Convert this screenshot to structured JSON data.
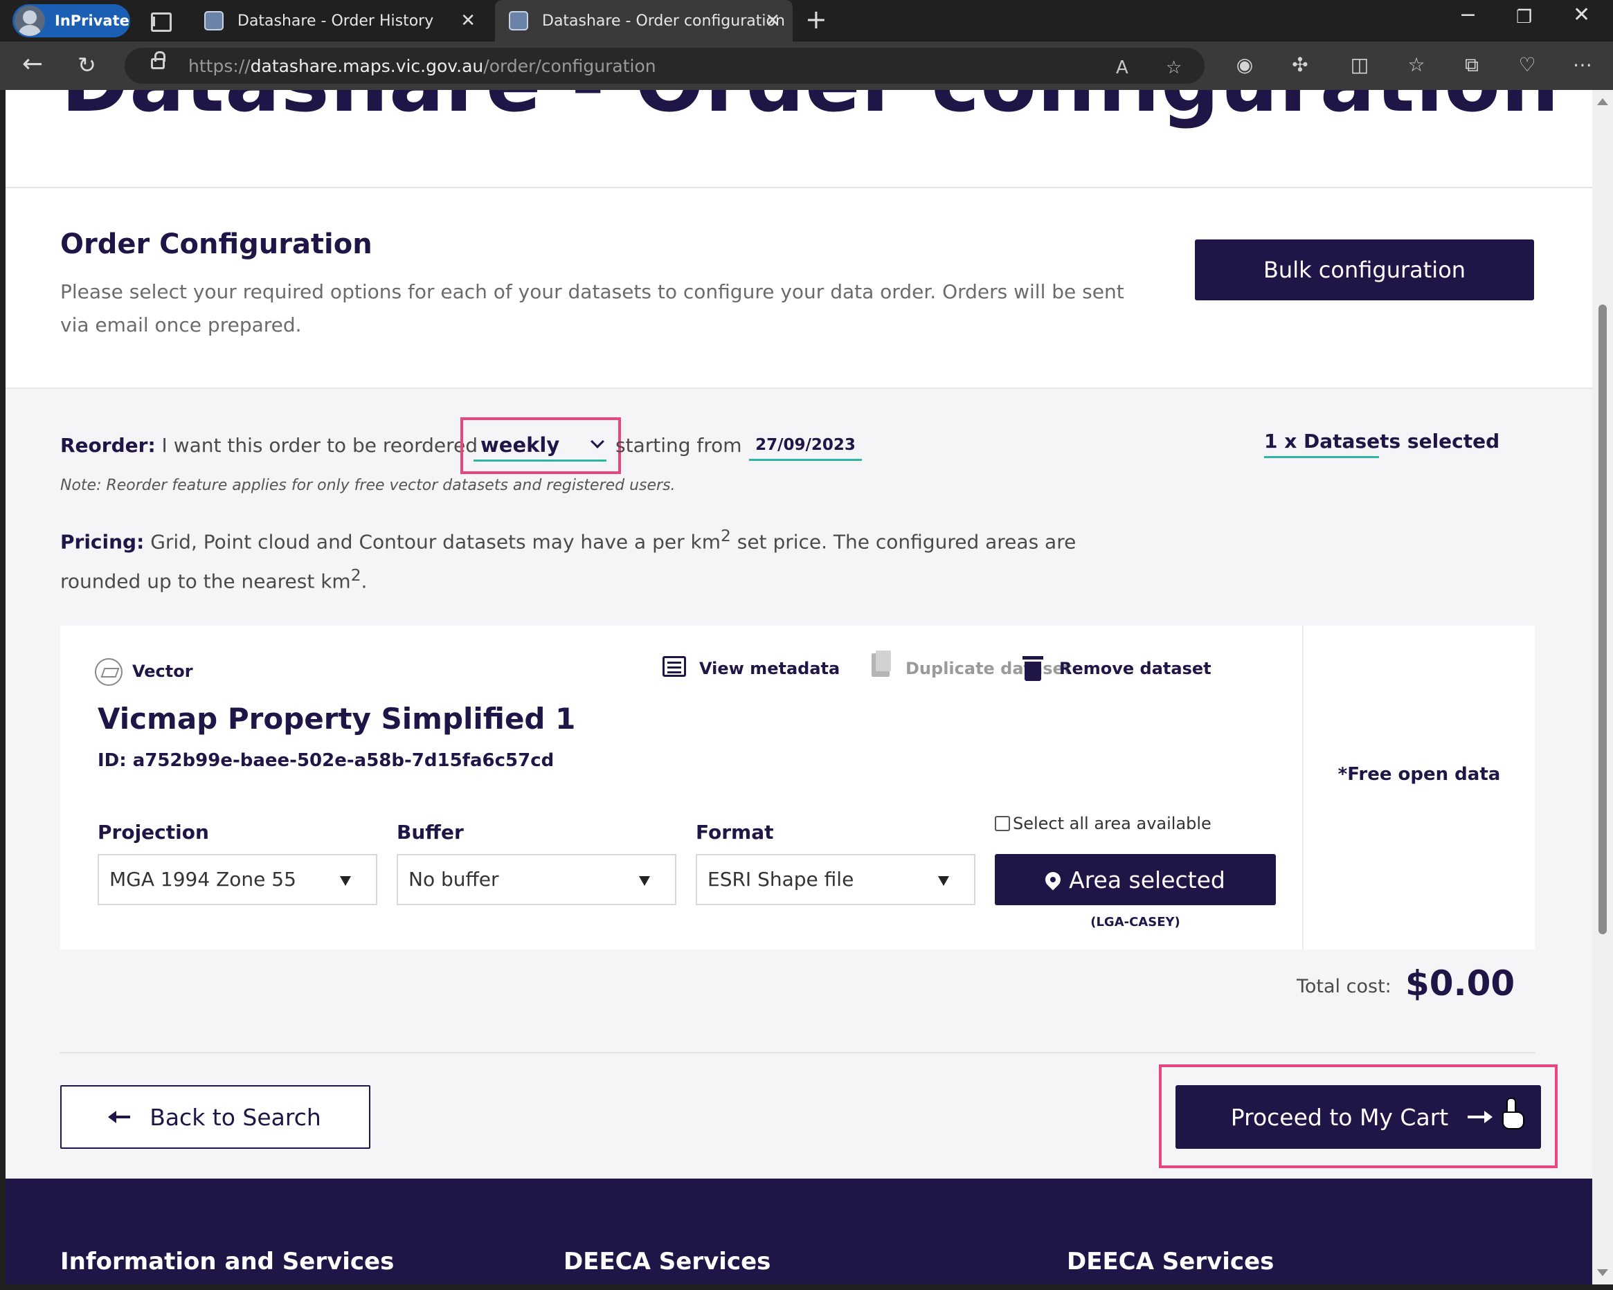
{
  "browser": {
    "inprivate_label": "InPrivate",
    "tabs": [
      {
        "title": "Datashare - Order History",
        "active": false
      },
      {
        "title": "Datashare - Order configuration",
        "active": true
      }
    ],
    "url_prefix": "https://",
    "url_host": "datashare.maps.vic.gov.au",
    "url_path": "/order/configuration"
  },
  "page": {
    "big_title": "Datashare - Order configuration",
    "section_title": "Order Configuration",
    "section_desc": "Please select your required options for each of your datasets to configure your data order. Orders will be sent via email once prepared.",
    "bulk_button": "Bulk configuration",
    "reorder": {
      "label": "Reorder:",
      "text": " I want this order to be reordered",
      "frequency": "weekly",
      "starting_text": "starting from",
      "start_date": "27/09/2023"
    },
    "datasets_selected": "1 x Datasets selected",
    "note": "Note: Reorder feature applies for only free vector datasets and registered users.",
    "pricing": {
      "label": "Pricing:",
      "text_1": " Grid, Point cloud and Contour datasets may have a per km",
      "sup_1": "2",
      "text_2": " set price. The configured areas are rounded up to the nearest km",
      "sup_2": "2",
      "text_3": "."
    },
    "dataset": {
      "type": "Vector",
      "actions": {
        "view_metadata": "View metadata",
        "duplicate": "Duplicate dataset",
        "remove": "Remove dataset"
      },
      "title": "Vicmap Property Simplified 1",
      "id": "ID: a752b99e-baee-502e-a58b-7d15fa6c57cd",
      "projection_label": "Projection",
      "projection_value": "MGA 1994 Zone 55",
      "buffer_label": "Buffer",
      "buffer_value": "No buffer",
      "format_label": "Format",
      "format_value": "ESRI Shape file",
      "select_all_area": "Select all area available",
      "select_all_checked": false,
      "area_button": "Area selected",
      "area_name": "(LGA-CASEY)",
      "price_note": "*Free open data"
    },
    "total_label": "Total cost:",
    "total_value": "$0.00",
    "back_button": "Back to Search",
    "proceed_button": "Proceed to My Cart",
    "footer": {
      "col1": "Information and Services",
      "col2": "DEECA Services",
      "col3": "DEECA Services"
    }
  },
  "colors": {
    "brand_navy": "#201547",
    "accent_teal": "#2db6a7",
    "highlight_pink": "#e8467c"
  }
}
